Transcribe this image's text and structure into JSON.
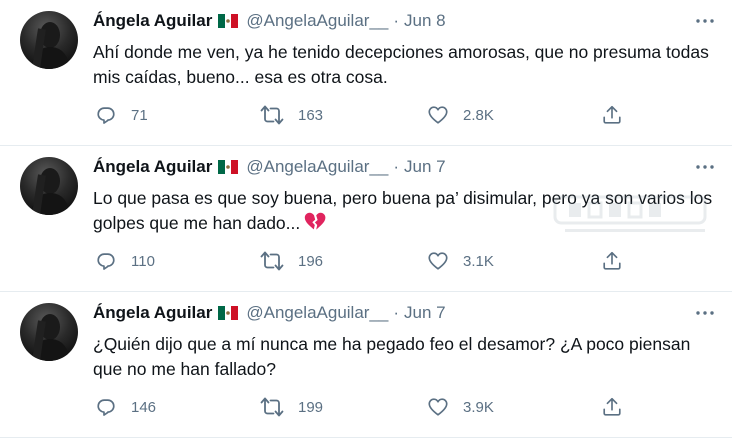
{
  "tweets": [
    {
      "name": "Ángela Aguilar",
      "flag": "mexico-flag",
      "handle": "@AngelaAguilar__",
      "separator": "·",
      "date": "Jun 8",
      "text": "Ahí donde me ven, ya he tenido decepciones amorosas, que no presuma todas mis caídas, bueno... esa es otra cosa.",
      "emoji": "",
      "replies": "71",
      "retweets": "163",
      "likes": "2.8K"
    },
    {
      "name": "Ángela Aguilar",
      "flag": "mexico-flag",
      "handle": "@AngelaAguilar__",
      "separator": "·",
      "date": "Jun 7",
      "text": "Lo que pasa es que soy buena, pero buena pa’ disimular, pero ya son varios los golpes que me han dado...",
      "emoji": "broken-heart",
      "replies": "110",
      "retweets": "196",
      "likes": "3.1K"
    },
    {
      "name": "Ángela Aguilar",
      "flag": "mexico-flag",
      "handle": "@AngelaAguilar__",
      "separator": "·",
      "date": "Jun 7",
      "text": "¿Quién dijo que a mí nunca me ha pegado feo el desamor? ¿A poco piensan que no me han fallado?",
      "emoji": "",
      "replies": "146",
      "retweets": "199",
      "likes": "3.9K"
    }
  ],
  "icons": {
    "reply": "reply-icon",
    "retweet": "retweet-icon",
    "like": "heart-icon",
    "share": "share-icon",
    "more": "more-icon"
  },
  "colors": {
    "text": "#0f1419",
    "secondary": "#5b7083",
    "divider": "#e6ecf0",
    "broken_heart": "#e0245e"
  }
}
